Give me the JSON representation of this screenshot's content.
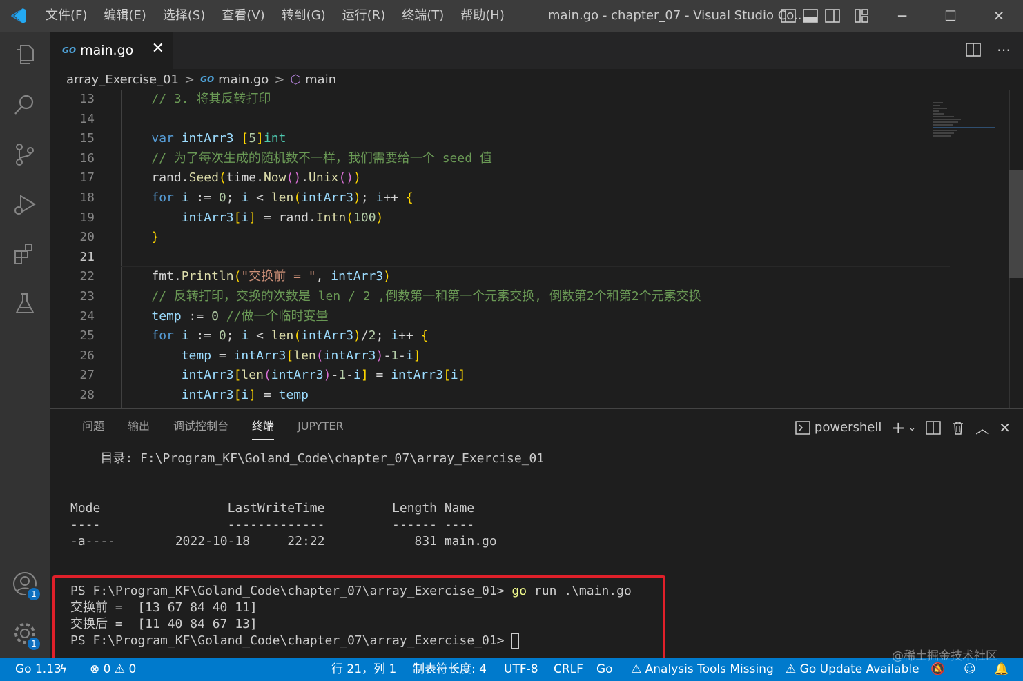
{
  "menu": [
    "文件(F)",
    "编辑(E)",
    "选择(S)",
    "查看(V)",
    "转到(G)",
    "运行(R)",
    "终端(T)",
    "帮助(H)"
  ],
  "window_title": "main.go - chapter_07 - Visual Studio Co...",
  "window_controls": {
    "minimize": "─",
    "maximize": "☐",
    "close": "✕"
  },
  "tab": {
    "icon": "GO",
    "label": "main.go",
    "close": "✕"
  },
  "breadcrumb": {
    "folder": "array_Exercise_01",
    "file": "main.go",
    "symbol": "main",
    "sep": ">"
  },
  "editor": {
    "line_numbers": [
      "13",
      "14",
      "15",
      "16",
      "17",
      "18",
      "19",
      "20",
      "21",
      "22",
      "23",
      "24",
      "25",
      "26",
      "27",
      "28"
    ],
    "active_line": "21",
    "lines": [
      "    // 3. 将其反转打印",
      "",
      "    var intArr3 [5]int",
      "    // 为了每次生成的随机数不一样，我们需要给一个 seed 值",
      "    rand.Seed(time.Now().Unix())",
      "    for i := 0; i < len(intArr3); i++ {",
      "        intArr3[i] = rand.Intn(100)",
      "    }",
      "",
      "    fmt.Println(\"交换前 = \", intArr3)",
      "    // 反转打印，交换的次数是 len / 2 ,倒数第一和第一个元素交换, 倒数第2个和第2个元素交换",
      "    temp := 0 //做一个临时变量",
      "    for i := 0; i < len(intArr3)/2; i++ {",
      "        temp = intArr3[len(intArr3)-1-i]",
      "        intArr3[len(intArr3)-1-i] = intArr3[i]",
      "        intArr3[i] = temp"
    ]
  },
  "panel": {
    "tabs": [
      "问题",
      "输出",
      "调试控制台",
      "终端",
      "JUPYTER"
    ],
    "active_tab": "终端",
    "shell": "powershell",
    "terminal_lines": [
      "    目录: F:\\Program_KF\\Goland_Code\\chapter_07\\array_Exercise_01",
      "",
      "",
      "Mode                 LastWriteTime         Length Name",
      "----                 -------------         ------ ----",
      "-a----        2022-10-18     22:22            831 main.go",
      "",
      "",
      "PS F:\\Program_KF\\Goland_Code\\chapter_07\\array_Exercise_01> go run .\\main.go",
      "交换前 =  [13 67 84 40 11]",
      "交换后 =  [11 40 84 67 13]",
      "PS F:\\Program_KF\\Goland_Code\\chapter_07\\array_Exercise_01> "
    ]
  },
  "statusbar": {
    "go_version": "Go 1.13",
    "errors": "0",
    "warnings": "0",
    "position": "行 21，列 1",
    "indent": "制表符长度: 4",
    "encoding": "UTF-8",
    "eol": "CRLF",
    "language": "Go",
    "analysis": "Analysis Tools Missing",
    "update": "Go Update Available"
  },
  "activity_badges": {
    "accounts": "1",
    "manage": "1"
  },
  "watermark": "@稀土掘金技术社区",
  "colors": {
    "accent": "#007acc",
    "highlight_box": "#e0202a",
    "badge": "#0e70c0"
  }
}
